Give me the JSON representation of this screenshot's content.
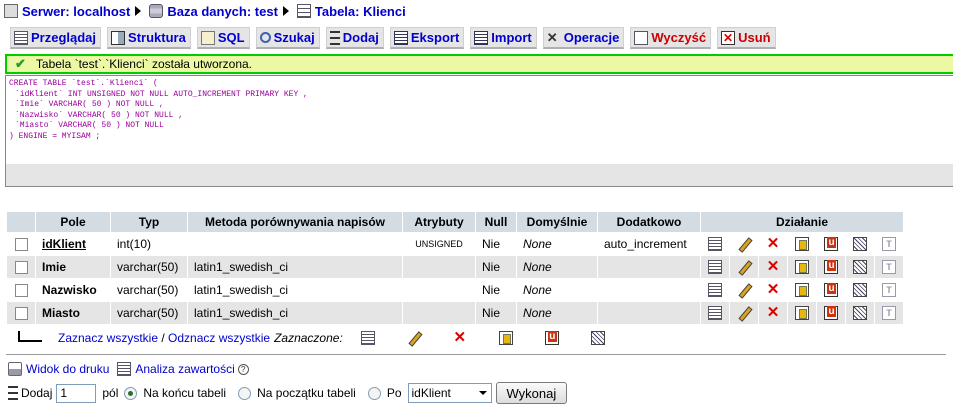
{
  "breadcrumb": [
    {
      "label": "Serwer: localhost",
      "icon": "server-icon"
    },
    {
      "label": "Baza danych: test",
      "icon": "database-icon"
    },
    {
      "label": "Tabela: Klienci",
      "icon": "table-icon"
    }
  ],
  "tabs": [
    {
      "label": "Przeglądaj",
      "icon": "browse-icon"
    },
    {
      "label": "Struktura",
      "icon": "structure-icon"
    },
    {
      "label": "SQL",
      "icon": "sql-icon"
    },
    {
      "label": "Szukaj",
      "icon": "search-icon"
    },
    {
      "label": "Dodaj",
      "icon": "insert-icon"
    },
    {
      "label": "Eksport",
      "icon": "export-icon"
    },
    {
      "label": "Import",
      "icon": "import-icon"
    },
    {
      "label": "Operacje",
      "icon": "operations-icon"
    },
    {
      "label": "Wyczyść",
      "icon": "empty-icon"
    },
    {
      "label": "Usuń",
      "icon": "drop-icon"
    }
  ],
  "notice": {
    "text": "Tabela `test`.`Klienci` została utworzona."
  },
  "sql": {
    "lines": [
      "CREATE TABLE `test`.`Klienci` (",
      "`idKlient` INT UNSIGNED NOT NULL AUTO_INCREMENT PRIMARY KEY ,",
      "`Imie` VARCHAR( 50 ) NOT NULL ,",
      "`Nazwisko` VARCHAR( 50 ) NOT NULL ,",
      "`Miasto` VARCHAR( 50 ) NOT NULL",
      ") ENGINE = MYISAM ;"
    ]
  },
  "table": {
    "headers": {
      "field": "Pole",
      "type": "Typ",
      "collation": "Metoda porównywania napisów",
      "attributes": "Atrybuty",
      "null": "Null",
      "default": "Domyślnie",
      "extra": "Dodatkowo",
      "action": "Działanie"
    },
    "rows": [
      {
        "field": "idKlient",
        "type": "int(10)",
        "collation": "",
        "attributes": "UNSIGNED",
        "null": "Nie",
        "default": "None",
        "extra": "auto_increment"
      },
      {
        "field": "Imie",
        "type": "varchar(50)",
        "collation": "latin1_swedish_ci",
        "attributes": "",
        "null": "Nie",
        "default": "None",
        "extra": ""
      },
      {
        "field": "Nazwisko",
        "type": "varchar(50)",
        "collation": "latin1_swedish_ci",
        "attributes": "",
        "null": "Nie",
        "default": "None",
        "extra": ""
      },
      {
        "field": "Miasto",
        "type": "varchar(50)",
        "collation": "latin1_swedish_ci",
        "attributes": "",
        "null": "Nie",
        "default": "None",
        "extra": ""
      }
    ]
  },
  "checkall": {
    "select_all": "Zaznacz wszystkie",
    "separator": " / ",
    "deselect_all": "Odznacz wszystkie",
    "selected_label": "Zaznaczone:"
  },
  "links": {
    "print_view": "Widok do druku",
    "analyze": "Analiza zawartości"
  },
  "add_fields": {
    "prefix": "Dodaj",
    "count": "1",
    "suffix": "pól",
    "at_end": "Na końcu tabeli",
    "at_start": "Na początku tabeli",
    "after": "Po",
    "after_field": "idKlient",
    "go": "Wykonaj"
  }
}
